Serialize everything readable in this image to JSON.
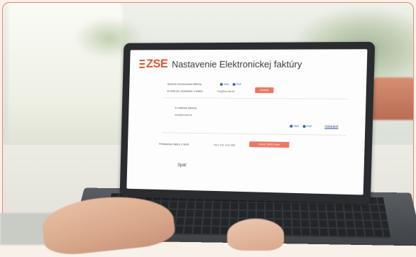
{
  "screen": {
    "logo": "ZSE",
    "title": "Nastavenie Elektronickej faktúry",
    "labels": {
      "format": "Spôsob doručovania faktúry",
      "email": "E-mail pre zasielanie e-faktúr",
      "extra_email": "E-mailová adresa",
      "sms": "Prihlásenie faktúr z SMS"
    },
    "values": {
      "email": "moj@email.sk",
      "extra_email": "test@email.sk",
      "phone": "+421 911 123 456"
    },
    "radio": {
      "pdf": "PDF",
      "xml": "XML"
    },
    "buttons": {
      "change": "Zmeniť",
      "save_sms": "Uložiť SMS číslo"
    },
    "links": {
      "remove": "Odstrániť",
      "back": "Späť"
    }
  },
  "colors": {
    "brand": "#e2522f",
    "button": "#ee7763",
    "frame_border": "#e58a6f"
  }
}
